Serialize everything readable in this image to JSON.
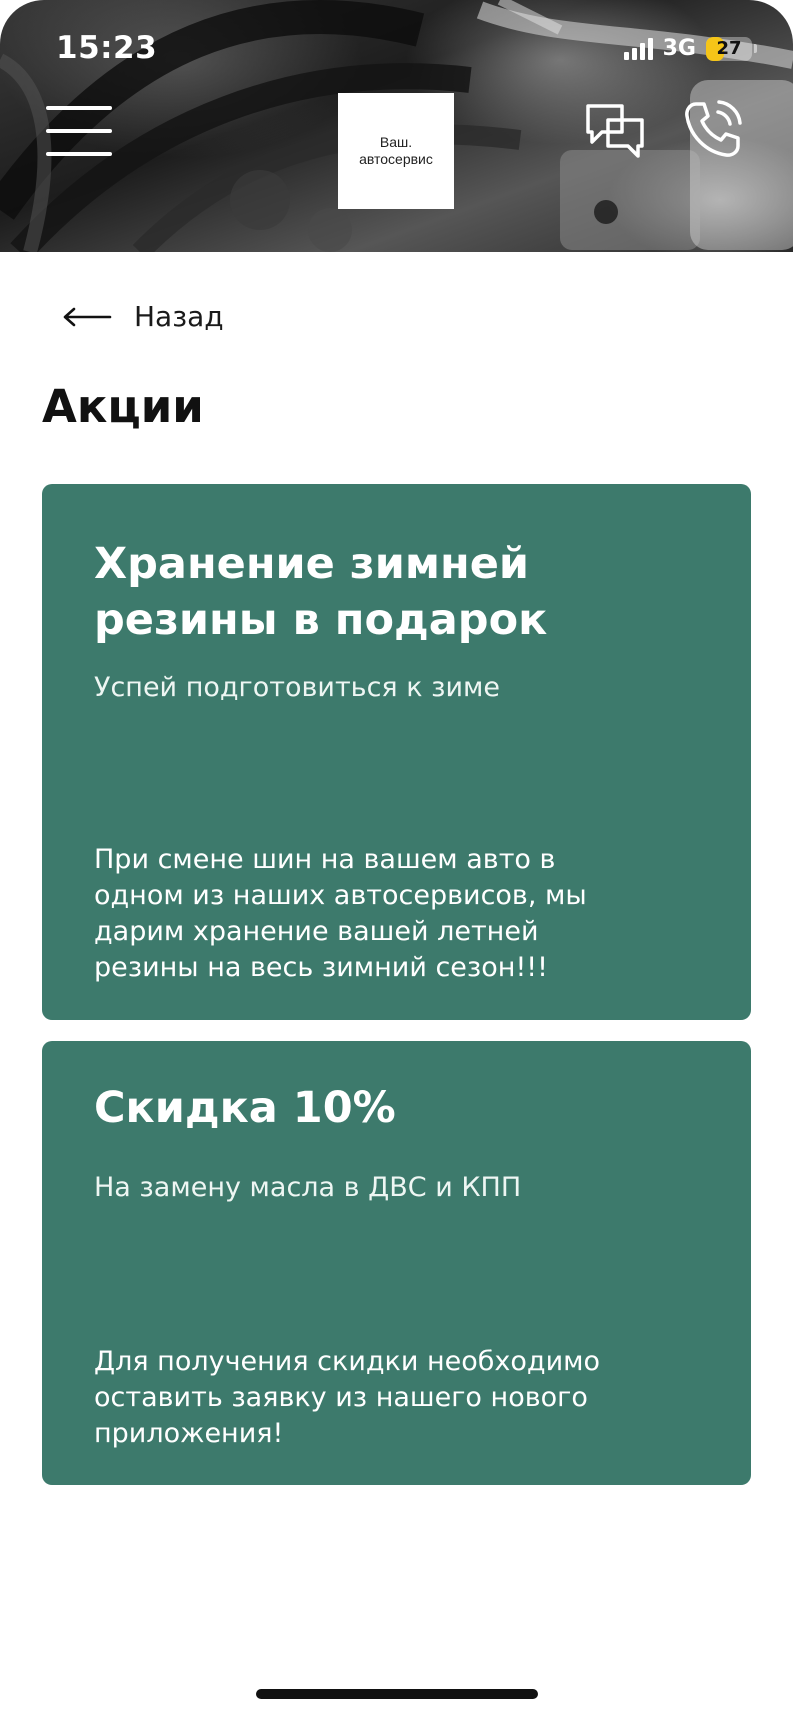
{
  "status_bar": {
    "time": "15:23",
    "network": "3G",
    "battery": "27",
    "battery_level": 0.27
  },
  "header": {
    "logo_line1": "Ваш.",
    "logo_line2": "автосервис",
    "menu_icon": "hamburger-menu-icon",
    "chat_icon": "chat-bubbles-icon",
    "phone_icon": "phone-call-icon"
  },
  "nav": {
    "back_label": "Назад",
    "back_icon": "arrow-left-icon"
  },
  "page": {
    "title": "Акции"
  },
  "promotions": [
    {
      "title_line1": "Хранение зимней",
      "title_line2": "резины в подарок",
      "subtitle": "Успей подготовиться к зиме",
      "body_lines": [
        "При смене шин на вашем авто в",
        "одном из наших автосервисов, мы",
        "дарим хранение вашей летней",
        "резины на весь зимний сезон!!!"
      ]
    },
    {
      "title_line1": "Скидка 10%",
      "subtitle": "На замену масла в ДВС и КПП",
      "body_lines": [
        "Для получения скидки необходимо",
        "оставить заявку из нашего нового",
        "приложения!"
      ]
    }
  ],
  "colors": {
    "card_bg": "#3d7a6c",
    "text_dark": "#111111",
    "battery": "#f5c518"
  }
}
